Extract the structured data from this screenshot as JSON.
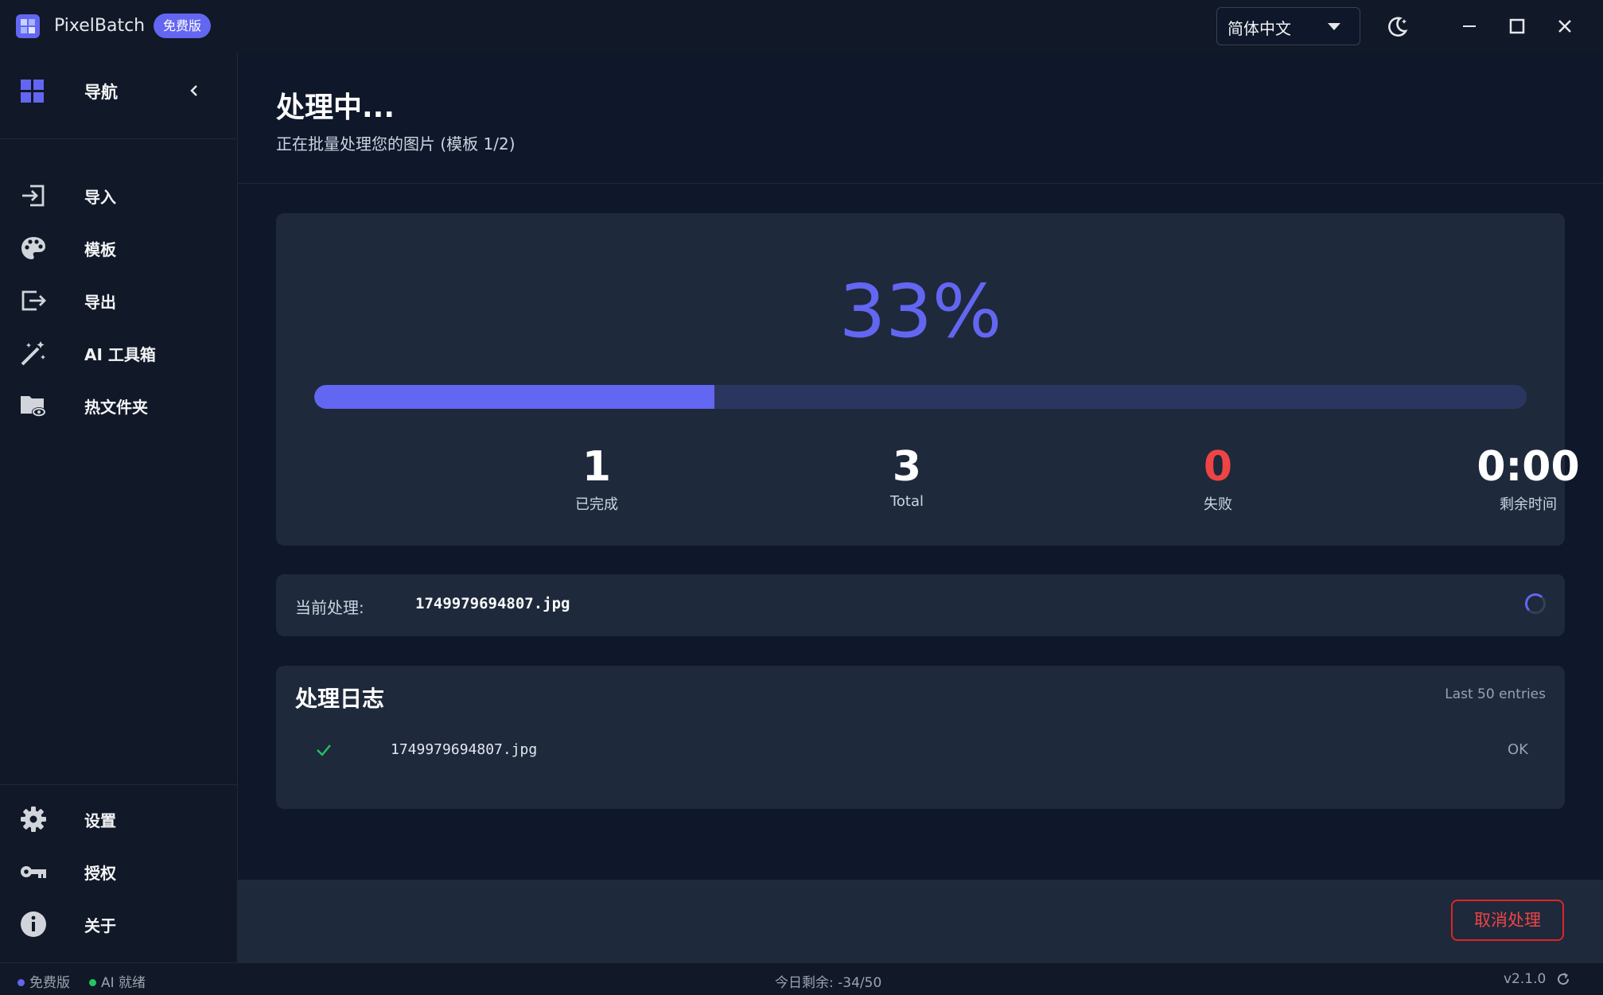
{
  "app": {
    "name": "PixelBatch",
    "edition_badge": "免费版",
    "language": "简体中文"
  },
  "sidebar": {
    "header": "导航",
    "items": [
      {
        "label": "导入",
        "icon": "import-icon"
      },
      {
        "label": "模板",
        "icon": "palette-icon"
      },
      {
        "label": "导出",
        "icon": "export-icon"
      },
      {
        "label": "AI 工具箱",
        "icon": "magic-wand-icon"
      },
      {
        "label": "热文件夹",
        "icon": "hot-folder-icon"
      }
    ],
    "bottom_items": [
      {
        "label": "设置",
        "icon": "gear-icon"
      },
      {
        "label": "授权",
        "icon": "key-icon"
      },
      {
        "label": "关于",
        "icon": "info-icon"
      }
    ]
  },
  "page": {
    "title": "处理中...",
    "subtitle": "正在批量处理您的图片  (模板 1/2)"
  },
  "progress": {
    "percent_text": "33%",
    "fraction": 0.33,
    "stats": [
      {
        "value": "1",
        "label": "已完成"
      },
      {
        "value": "3",
        "label": "Total"
      },
      {
        "value": "0",
        "label": "失败"
      },
      {
        "value": "0:00",
        "label": "剩余时间"
      }
    ]
  },
  "current": {
    "label": "当前处理:",
    "file": "1749979694807.jpg"
  },
  "log": {
    "title": "处理日志",
    "meta": "Last 50 entries",
    "entries": [
      {
        "file": "1749979694807.jpg",
        "status": "OK"
      }
    ]
  },
  "actions": {
    "cancel": "取消处理"
  },
  "statusbar": {
    "edition": "免费版",
    "ai_status": "AI 就绪",
    "quota": "今日剩余: -34/50",
    "version": "v2.1.0"
  },
  "colors": {
    "accent": "#6366f1",
    "success": "#22c55e",
    "danger": "#ef4444",
    "background": "#0f172a",
    "panel": "#1e293b"
  }
}
